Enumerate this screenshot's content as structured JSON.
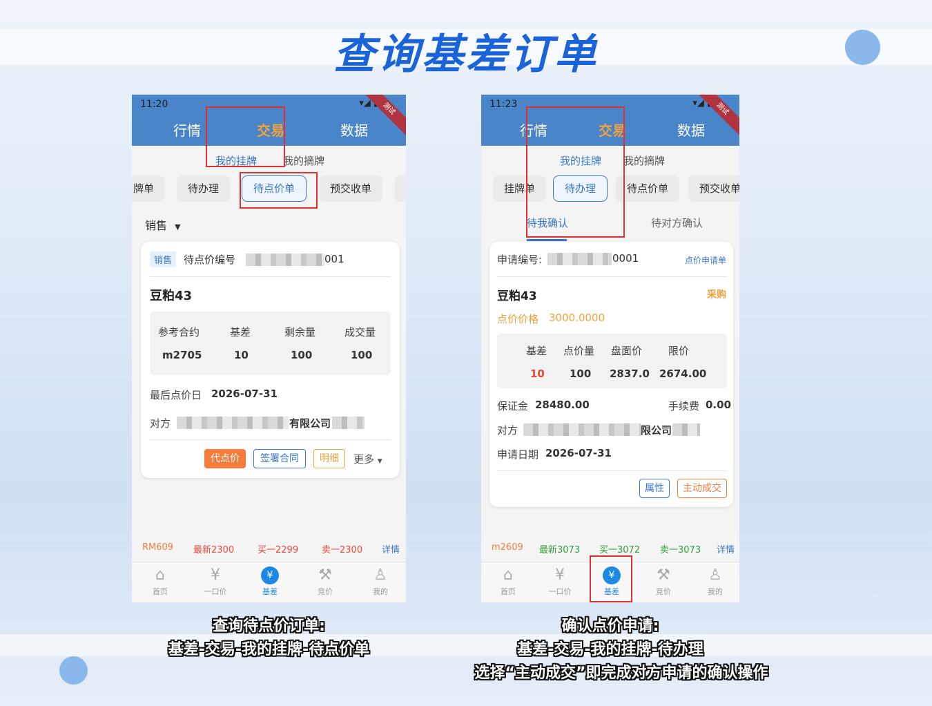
{
  "page_title": "查询基差订单",
  "left_phone": {
    "status_time": "11:20",
    "status_icons": "▾◢ ▮",
    "ribbon": "测试",
    "top_tabs": [
      "行情",
      "交易",
      "数据"
    ],
    "sub_tabs": [
      "我的挂牌",
      "我的摘牌"
    ],
    "chips": [
      "牌单",
      "待办理",
      "待点价单",
      "预交收单"
    ],
    "filter": "销售",
    "card": {
      "tag": "销售",
      "order_no_label": "待点价编号",
      "order_no_suffix": "001",
      "product": "豆粕43",
      "col_headers": [
        "参考合约",
        "基差",
        "剩余量",
        "成交量"
      ],
      "col_values": [
        "m2705",
        "10",
        "100",
        "100"
      ],
      "last_date_label": "最后点价日",
      "last_date_value": "2026-07-31",
      "party_label": "对方",
      "party_suffix": "有限公司",
      "buttons": [
        "代点价",
        "签署合同",
        "明细"
      ],
      "more": "更多"
    },
    "ticker": [
      "RM609",
      "最新2300",
      "买一2299",
      "卖一2300",
      "详情"
    ],
    "nav": [
      "首页",
      "一口价",
      "基差",
      "竞价",
      "我的"
    ]
  },
  "right_phone": {
    "status_time": "11:23",
    "status_icons": "▾◢ ▮",
    "ribbon": "测试",
    "top_tabs": [
      "行情",
      "交易",
      "数据"
    ],
    "sub_tabs": [
      "我的挂牌",
      "我的摘牌"
    ],
    "chips": [
      "挂牌单",
      "待办理",
      "待点价单",
      "预交收单"
    ],
    "sub_sub_tabs": [
      "待我确认",
      "待对方确认"
    ],
    "card": {
      "apply_no_label": "申请编号:",
      "apply_no_suffix": "0001",
      "apply_link": "点价申请单",
      "product": "豆粕43",
      "direction": "采购",
      "price_label": "点价价格",
      "price_value": "3000.0000",
      "col_headers": [
        "基差",
        "点价量",
        "盘面价",
        "限价"
      ],
      "col_values": [
        "10",
        "100",
        "2837.0",
        "2674.00"
      ],
      "margin_label": "保证金",
      "margin_value": "28480.00",
      "fee_label": "手续费",
      "fee_value": "0.00",
      "party_label": "对方",
      "party_suffix": "限公司",
      "date_label": "申请日期",
      "date_value": "2026-07-31",
      "buttons": [
        "属性",
        "主动成交"
      ]
    },
    "ticker": [
      "m2609",
      "最新3073",
      "买一3072",
      "卖一3073",
      "详情"
    ],
    "nav": [
      "首页",
      "一口价",
      "基差",
      "竞价",
      "我的"
    ]
  },
  "captions": {
    "left": [
      "查询待点价订单:",
      "基差-交易-我的挂牌-待点价单"
    ],
    "right": [
      "确认点价申请:",
      "基差-交易-我的挂牌-待办理",
      "选择“主动成交”即完成对方申请的确认操作"
    ]
  },
  "colors": {
    "header_blue": "#4a84c9",
    "accent_blue": "#3a78c7",
    "orange": "#f1a13b",
    "highlight_red": "#e03131",
    "title_blue": "#1a63d9"
  }
}
